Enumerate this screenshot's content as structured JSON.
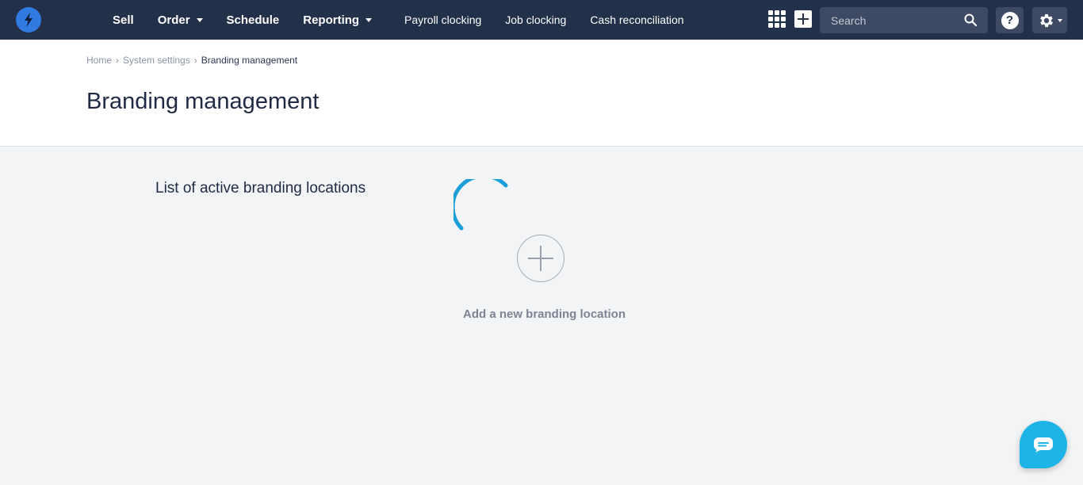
{
  "nav": {
    "main": [
      {
        "label": "Sell",
        "dropdown": false
      },
      {
        "label": "Order",
        "dropdown": true
      },
      {
        "label": "Schedule",
        "dropdown": false
      },
      {
        "label": "Reporting",
        "dropdown": true
      }
    ],
    "secondary": [
      "Payroll clocking",
      "Job clocking",
      "Cash reconciliation"
    ],
    "search_placeholder": "Search",
    "help_label": "?"
  },
  "breadcrumb": {
    "home": "Home",
    "system_settings": "System settings",
    "current": "Branding management"
  },
  "page": {
    "title": "Branding management",
    "section_title": "List of active branding locations",
    "add_label": "Add a new branding location"
  },
  "colors": {
    "nav_bg": "#233049",
    "accent": "#1fb4e6",
    "logo": "#2f7be0",
    "spinner": "#1a9fd8"
  },
  "icons": [
    "bolt-icon",
    "apps-grid-icon",
    "plus-icon",
    "search-icon",
    "help-icon",
    "gear-icon",
    "chevron-down-icon",
    "spinner-icon",
    "add-circle-icon",
    "chat-icon"
  ]
}
